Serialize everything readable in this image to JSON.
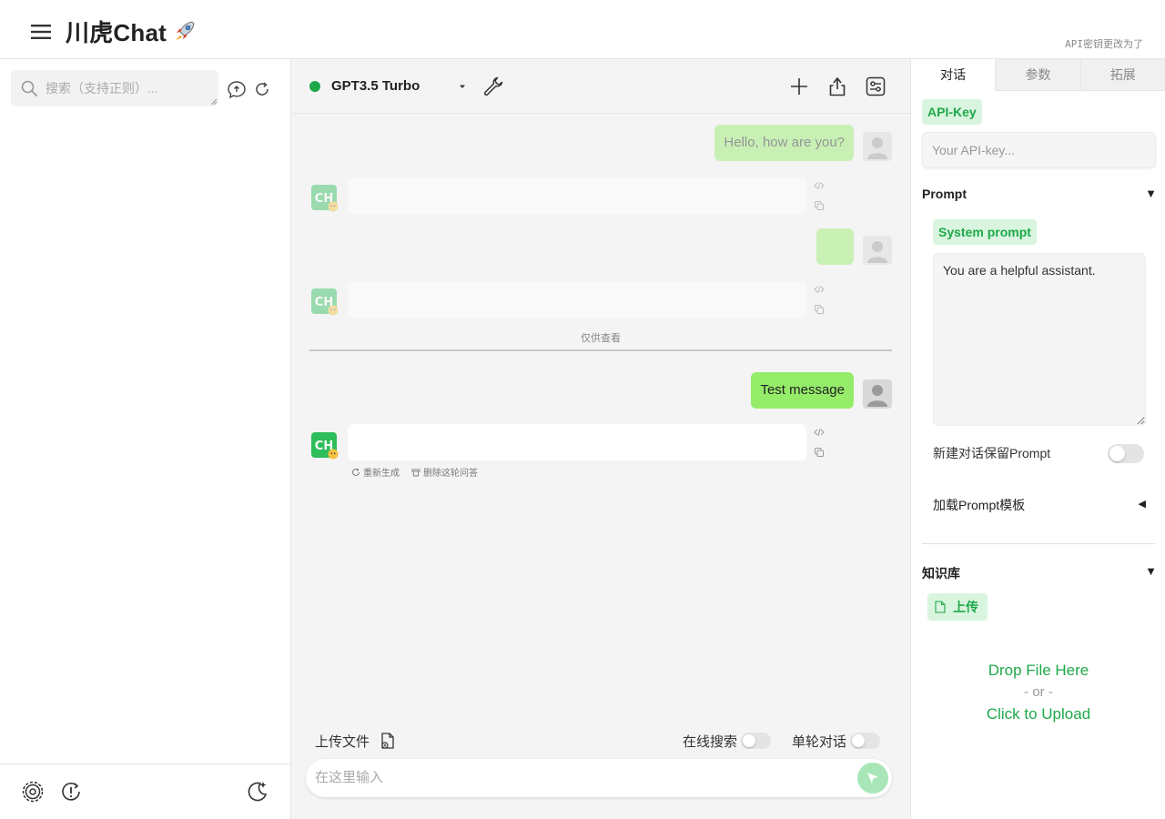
{
  "header": {
    "title": "川虎Chat",
    "api_note": "API密钥更改为了"
  },
  "sidebar": {
    "search_placeholder": "搜索（支持正则）..."
  },
  "toolbar": {
    "model_name": "GPT3.5 Turbo",
    "status_color": "#1fa84a"
  },
  "messages": [
    {
      "role": "user",
      "text": "Hello, how are you?",
      "faded": true
    },
    {
      "role": "assistant",
      "text": "",
      "faded": true
    },
    {
      "role": "user",
      "text": "",
      "faded": true
    },
    {
      "role": "assistant",
      "text": "",
      "faded": true
    },
    {
      "role": "user",
      "text": "Test message",
      "faded": false
    },
    {
      "role": "assistant",
      "text": "",
      "faded": false
    }
  ],
  "divider_label": "仅供查看",
  "actions": {
    "regenerate": "重新生成",
    "delete_round": "删除这轮问答"
  },
  "bottom": {
    "upload_label": "上传文件",
    "web_search_label": "在线搜索",
    "single_turn_label": "单轮对话",
    "input_placeholder": "在这里输入"
  },
  "right_panel": {
    "tabs": [
      "对话",
      "参数",
      "拓展"
    ],
    "api_key_label": "API-Key",
    "api_key_placeholder": "Your API-key...",
    "prompt_section": "Prompt",
    "system_prompt_label": "System prompt",
    "system_prompt_value": "You are a helpful assistant.",
    "keep_prompt_label": "新建对话保留Prompt",
    "load_template_label": "加载Prompt模板",
    "kb_section": "知识库",
    "upload_button": "上传",
    "drop_line": "Drop File Here",
    "or_line": "- or -",
    "click_line": "Click to Upload"
  },
  "colors": {
    "accent": "#1fa84a",
    "user_bubble": "#95ec69",
    "tag_bg": "#d9f5df"
  }
}
